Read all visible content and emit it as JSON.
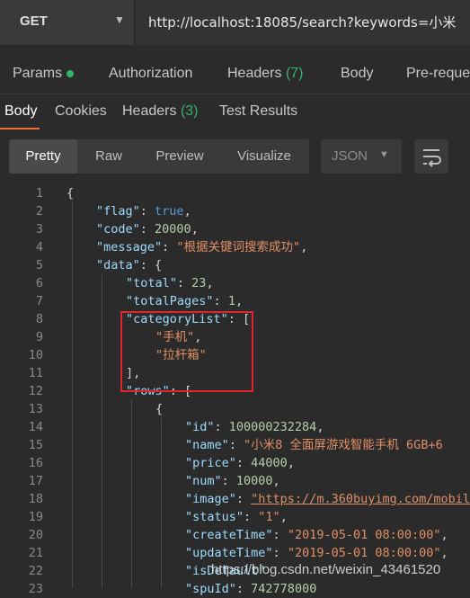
{
  "request": {
    "method": "GET",
    "url": "http://localhost:18085/search?keywords=小米"
  },
  "request_tabs": [
    "Params",
    "Authorization",
    "Headers",
    "(7)",
    "Body",
    "Pre-reque"
  ],
  "response_tabs": {
    "body": "Body",
    "cookies": "Cookies",
    "headers": "Headers",
    "headers_count": "(3)",
    "tests": "Test Results"
  },
  "view_modes": [
    "Pretty",
    "Raw",
    "Preview",
    "Visualize"
  ],
  "format": "JSON",
  "code_lines": [
    {
      "n": "1"
    },
    {
      "n": "2"
    },
    {
      "n": "3"
    },
    {
      "n": "4"
    },
    {
      "n": "5"
    },
    {
      "n": "6"
    },
    {
      "n": "7"
    },
    {
      "n": "8"
    },
    {
      "n": "9"
    },
    {
      "n": "10"
    },
    {
      "n": "11"
    },
    {
      "n": "12"
    },
    {
      "n": "13"
    },
    {
      "n": "14"
    },
    {
      "n": "15"
    },
    {
      "n": "16"
    },
    {
      "n": "17"
    },
    {
      "n": "18"
    },
    {
      "n": "19"
    },
    {
      "n": "20"
    },
    {
      "n": "21"
    },
    {
      "n": "22"
    },
    {
      "n": "23"
    }
  ],
  "tokens": {
    "l1": "{",
    "flag_k": "\"flag\"",
    "flag_v": "true",
    "code_k": "\"code\"",
    "code_v": "20000",
    "msg_k": "\"message\"",
    "msg_v": "\"根据关键词搜索成功\"",
    "data_k": "\"data\"",
    "total_k": "\"total\"",
    "total_v": "23",
    "tp_k": "\"totalPages\"",
    "tp_v": "1",
    "cl_k": "\"categoryList\"",
    "cl_1": "\"手机\"",
    "cl_2": "\"拉杆箱\"",
    "rows_k": "\"rows\"",
    "id_k": "\"id\"",
    "id_v": "100000232284",
    "name_k": "\"name\"",
    "name_v": "\"小米8 全面屏游戏智能手机 6GB+6",
    "price_k": "\"price\"",
    "price_v": "44000",
    "num_k": "\"num\"",
    "num_v": "10000",
    "image_k": "\"image\"",
    "image_v": "\"https://m.360buyimg.com/mobil",
    "status_k": "\"status\"",
    "status_v": "\"1\"",
    "ct_k": "\"createTime\"",
    "ct_v": "\"2019-05-01 08:00:00\"",
    "ut_k": "\"updateTime\"",
    "ut_v": "\"2019-05-01 08:00:00\"",
    "isd_k": "\"isDefault\"",
    "spu_k": "\"spuId\"",
    "spu_v": "742778000"
  },
  "watermark": "https://blog.csdn.net/weixin_43461520",
  "colors": {
    "accent": "#f26b3a",
    "highlight": "#e0262c",
    "ok": "#2fb36a"
  }
}
